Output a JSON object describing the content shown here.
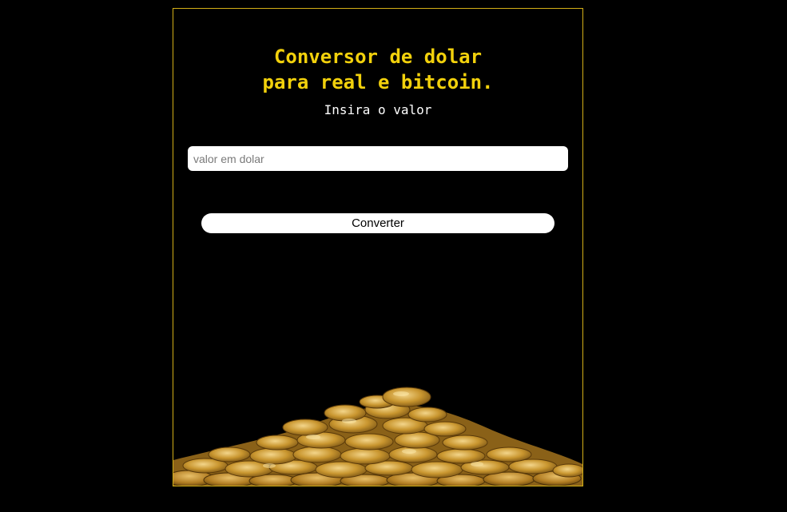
{
  "header": {
    "title_line1": "Conversor de dolar",
    "title_line2": "para real e bitcoin.",
    "subtitle": "Insira o valor"
  },
  "form": {
    "input_placeholder": "valor em dolar",
    "input_value": "",
    "button_label": "Converter"
  },
  "colors": {
    "page_background": "#000000",
    "accent_border": "#d4b017",
    "title_color": "#f2d10c",
    "text_color": "#ffffff"
  },
  "decoration": {
    "image": "pile-of-gold-coins"
  }
}
